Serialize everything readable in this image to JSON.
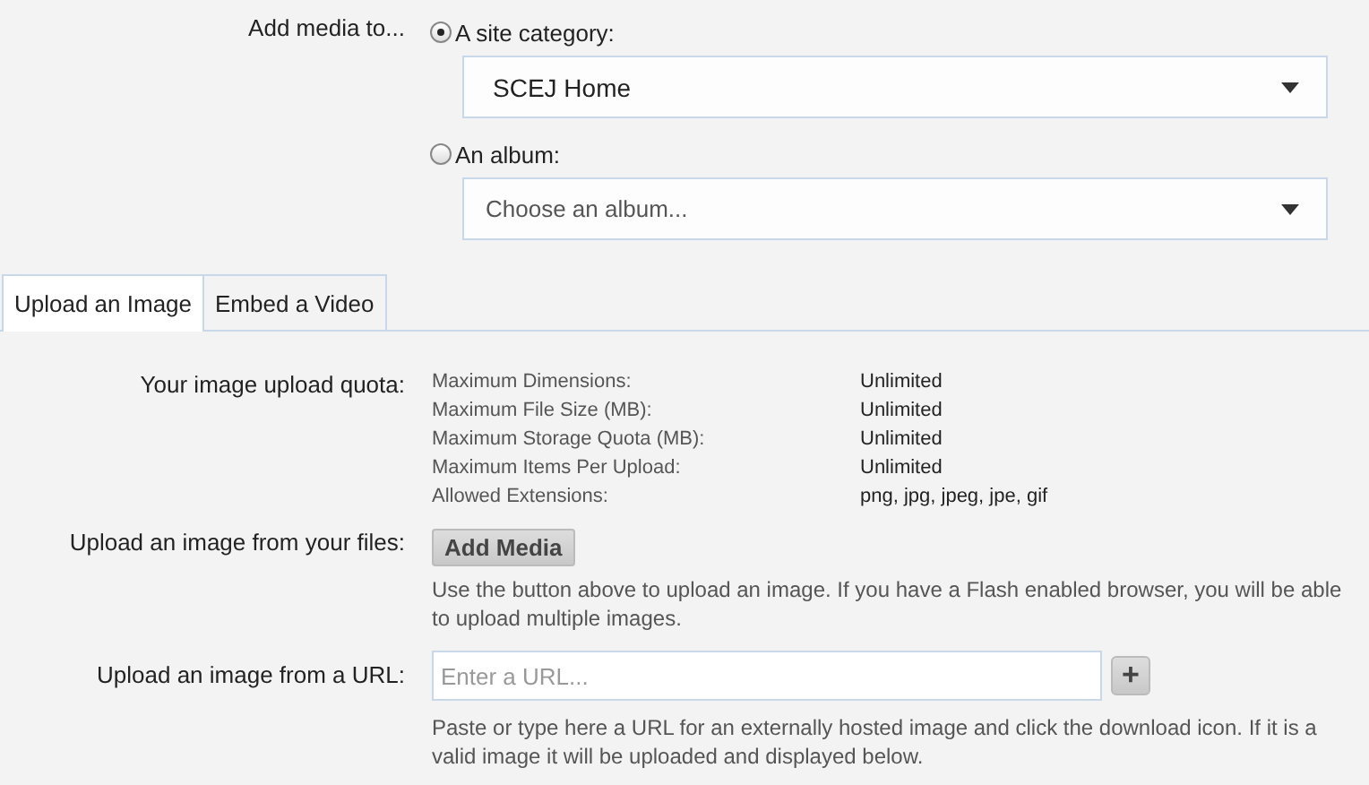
{
  "destination": {
    "label": "Add media to...",
    "options": [
      {
        "label": "A site category:",
        "selected": true,
        "select": {
          "value": "SCEJ Home"
        }
      },
      {
        "label": "An album:",
        "selected": false,
        "select": {
          "placeholder": "Choose an album..."
        }
      }
    ]
  },
  "tabs": [
    {
      "label": "Upload an Image",
      "selected": true
    },
    {
      "label": "Embed a Video",
      "selected": false
    }
  ],
  "quota": {
    "label": "Your image upload quota:",
    "rows": [
      {
        "name": "Maximum Dimensions:",
        "value": "Unlimited"
      },
      {
        "name": "Maximum File Size (MB):",
        "value": "Unlimited"
      },
      {
        "name": "Maximum Storage Quota (MB):",
        "value": "Unlimited"
      },
      {
        "name": "Maximum Items Per Upload:",
        "value": "Unlimited"
      },
      {
        "name": "Allowed Extensions:",
        "value": "png, jpg, jpeg, jpe, gif"
      }
    ]
  },
  "file_upload": {
    "label": "Upload an image from your files:",
    "button": "Add Media",
    "help": "Use the button above to upload an image. If you have a Flash enabled browser, you will be able to upload multiple images."
  },
  "url_upload": {
    "label": "Upload an image from a URL:",
    "placeholder": "Enter a URL...",
    "button": "+",
    "help": "Paste or type here a URL for an externally hosted image and click the download icon. If it is a valid image it will be uploaded and displayed below."
  }
}
